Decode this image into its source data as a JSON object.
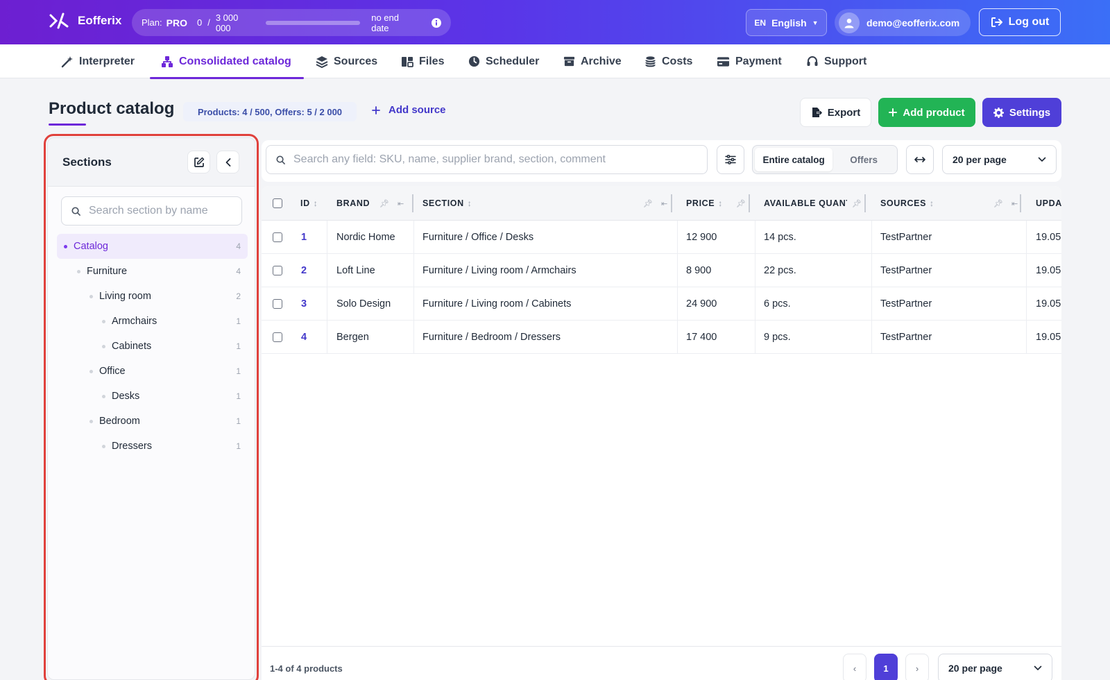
{
  "app": {
    "name": "Eofferix",
    "plan_label": "Plan:",
    "plan_name": "PRO",
    "usage_used": "0",
    "usage_sep": "/",
    "usage_limit": "3 000 000",
    "usage_fraction": 0,
    "plan_expiry": "no end date",
    "lang_code": "EN",
    "lang_name": "English",
    "user_email": "demo@eofferix.com",
    "logout_label": "Log out"
  },
  "nav": {
    "items": [
      {
        "label": "Interpreter",
        "icon": "wand-icon"
      },
      {
        "label": "Consolidated catalog",
        "icon": "catalog-icon"
      },
      {
        "label": "Sources",
        "icon": "layers-icon"
      },
      {
        "label": "Files",
        "icon": "files-icon"
      },
      {
        "label": "Scheduler",
        "icon": "clock-icon"
      },
      {
        "label": "Archive",
        "icon": "archive-icon"
      },
      {
        "label": "Costs",
        "icon": "coins-icon"
      },
      {
        "label": "Payment",
        "icon": "card-icon"
      },
      {
        "label": "Support",
        "icon": "headset-icon"
      }
    ],
    "active": "Consolidated catalog"
  },
  "page": {
    "title": "Product catalog",
    "counts": "Products: 4 / 500, Offers: 5 / 2 000",
    "add_source": "Add source",
    "export_label": "Export",
    "add_product_label": "Add product",
    "settings_label": "Settings"
  },
  "sections": {
    "title": "Sections",
    "search_placeholder": "Search section by name",
    "tree": [
      {
        "label": "Catalog",
        "count": "4",
        "level": 0,
        "active": true
      },
      {
        "label": "Furniture",
        "count": "4",
        "level": 1
      },
      {
        "label": "Living room",
        "count": "2",
        "level": 2
      },
      {
        "label": "Armchairs",
        "count": "1",
        "level": 3
      },
      {
        "label": "Cabinets",
        "count": "1",
        "level": 3
      },
      {
        "label": "Office",
        "count": "1",
        "level": 2
      },
      {
        "label": "Desks",
        "count": "1",
        "level": 3
      },
      {
        "label": "Bedroom",
        "count": "1",
        "level": 2
      },
      {
        "label": "Dressers",
        "count": "1",
        "level": 3
      }
    ]
  },
  "toolbar": {
    "search_placeholder": "Search any field: SKU, name, supplier brand, section, comment",
    "scope_options": [
      "Entire catalog",
      "Offers"
    ],
    "scope_selected": "Entire catalog",
    "per_page": "20 per page"
  },
  "table": {
    "columns": [
      "ID",
      "BRAND",
      "SECTION",
      "PRICE",
      "AVAILABLE QUANTITY",
      "SOURCES",
      "UPDATED"
    ],
    "rows": [
      {
        "id": "1",
        "brand": "Nordic Home",
        "section": "Furniture / Office / Desks",
        "price": "12 900",
        "qty": "14 pcs.",
        "sources": "TestPartner",
        "updated": "19.05"
      },
      {
        "id": "2",
        "brand": "Loft Line",
        "section": "Furniture / Living room / Armchairs",
        "price": "8 900",
        "qty": "22 pcs.",
        "sources": "TestPartner",
        "updated": "19.05"
      },
      {
        "id": "3",
        "brand": "Solo Design",
        "section": "Furniture / Living room / Cabinets",
        "price": "24 900",
        "qty": "6 pcs.",
        "sources": "TestPartner",
        "updated": "19.05"
      },
      {
        "id": "4",
        "brand": "Bergen",
        "section": "Furniture / Bedroom / Dressers",
        "price": "17 400",
        "qty": "9 pcs.",
        "sources": "TestPartner",
        "updated": "19.05"
      }
    ]
  },
  "footer": {
    "range_text": "1-4 of 4 products",
    "prev": "‹",
    "current_page": "1",
    "next": "›",
    "per_page": "20 per page"
  },
  "colors": {
    "accent": "#6d28d9",
    "primary_button": "#4f3fd8",
    "success_button": "#22b455",
    "highlight_border": "#e0413c"
  }
}
